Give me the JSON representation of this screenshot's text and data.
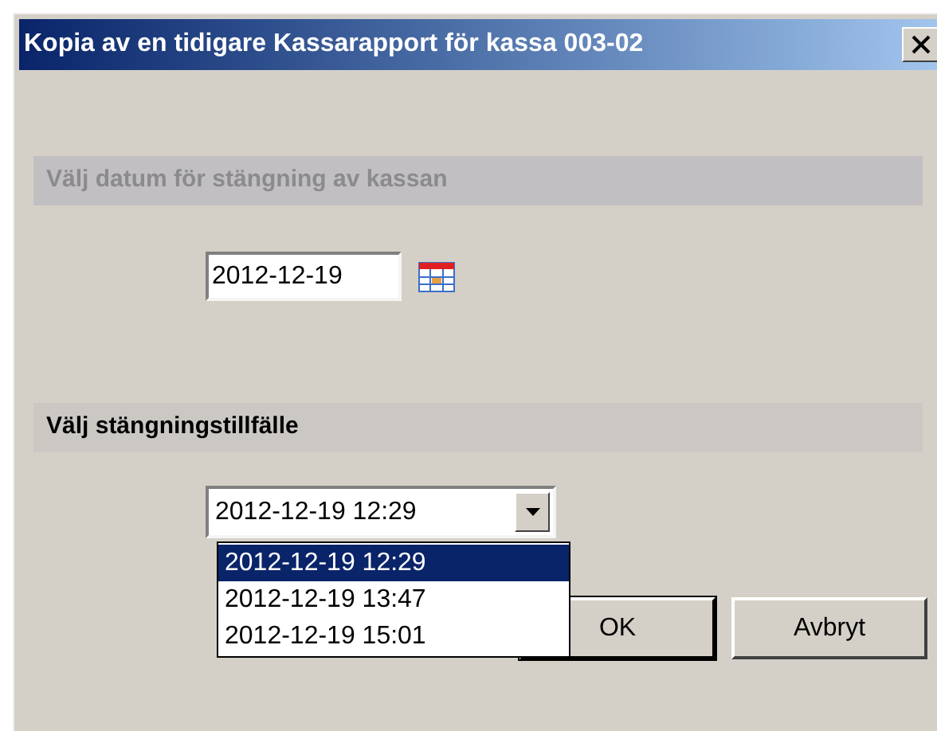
{
  "window": {
    "title": "Kopia av en tidigare Kassarapport för kassa 003-02"
  },
  "date_section": {
    "heading": "Välj datum för stängning av kassan",
    "disabled": true,
    "date_value": "2012-12-19"
  },
  "closing_section": {
    "heading": "Välj stängningstillfälle",
    "disabled": false,
    "combo_value": "2012-12-19 12:29",
    "expanded": true,
    "options": [
      {
        "label": "2012-12-19 12:29",
        "selected": true
      },
      {
        "label": "2012-12-19 13:47",
        "selected": false
      },
      {
        "label": "2012-12-19 15:01",
        "selected": false
      }
    ]
  },
  "buttons": [
    {
      "label": "OK",
      "default": true
    },
    {
      "label": "Avbryt",
      "default": false
    }
  ]
}
